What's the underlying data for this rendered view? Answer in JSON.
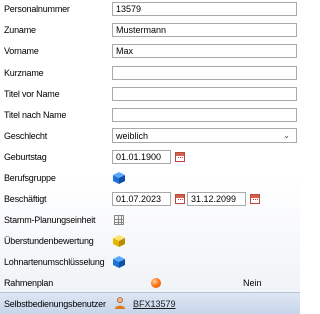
{
  "fields": {
    "personalnummer": {
      "label": "Personalnummer",
      "value": "13579"
    },
    "zuname": {
      "label": "Zuname",
      "value": "Mustermann"
    },
    "vorname": {
      "label": "Vorname",
      "value": "Max"
    },
    "kurzname": {
      "label": "Kurzname",
      "value": ""
    },
    "titel_vor": {
      "label": "Titel vor Name",
      "value": ""
    },
    "titel_nach": {
      "label": "Titel nach Name",
      "value": ""
    },
    "geschlecht": {
      "label": "Geschlecht",
      "value": "weiblich"
    },
    "geburtstag": {
      "label": "Geburtstag",
      "value": "01.01.1900"
    },
    "berufsgruppe": {
      "label": "Berufsgruppe"
    },
    "beschaeftigt": {
      "label": "Beschäftigt",
      "from": "01.07.2023",
      "to": "31.12.2099"
    },
    "stamm": {
      "label": "Stamm-Planungseinheit"
    },
    "ueberstunden": {
      "label": "Überstundenbewertung"
    },
    "lohnarten": {
      "label": "Lohnartenumschlüsselung"
    },
    "rahmenplan": {
      "label": "Rahmenplan",
      "value": "Nein"
    }
  },
  "footer": {
    "label": "Selbstbedienungsbenutzer",
    "link": "BFX13579"
  },
  "icons": {
    "calendar": "calendar-icon",
    "cube_blue": "blue-cube-icon",
    "cube_yellow": "yellow-cube-icon",
    "grid": "grid-icon",
    "status": "orange-status-dot",
    "user": "user-icon"
  },
  "colors": {
    "footer_bg": "#c7d5ea",
    "cube_blue": "#1e73d8",
    "cube_yellow": "#e8b400",
    "status_dot": "#ff7a1a"
  }
}
